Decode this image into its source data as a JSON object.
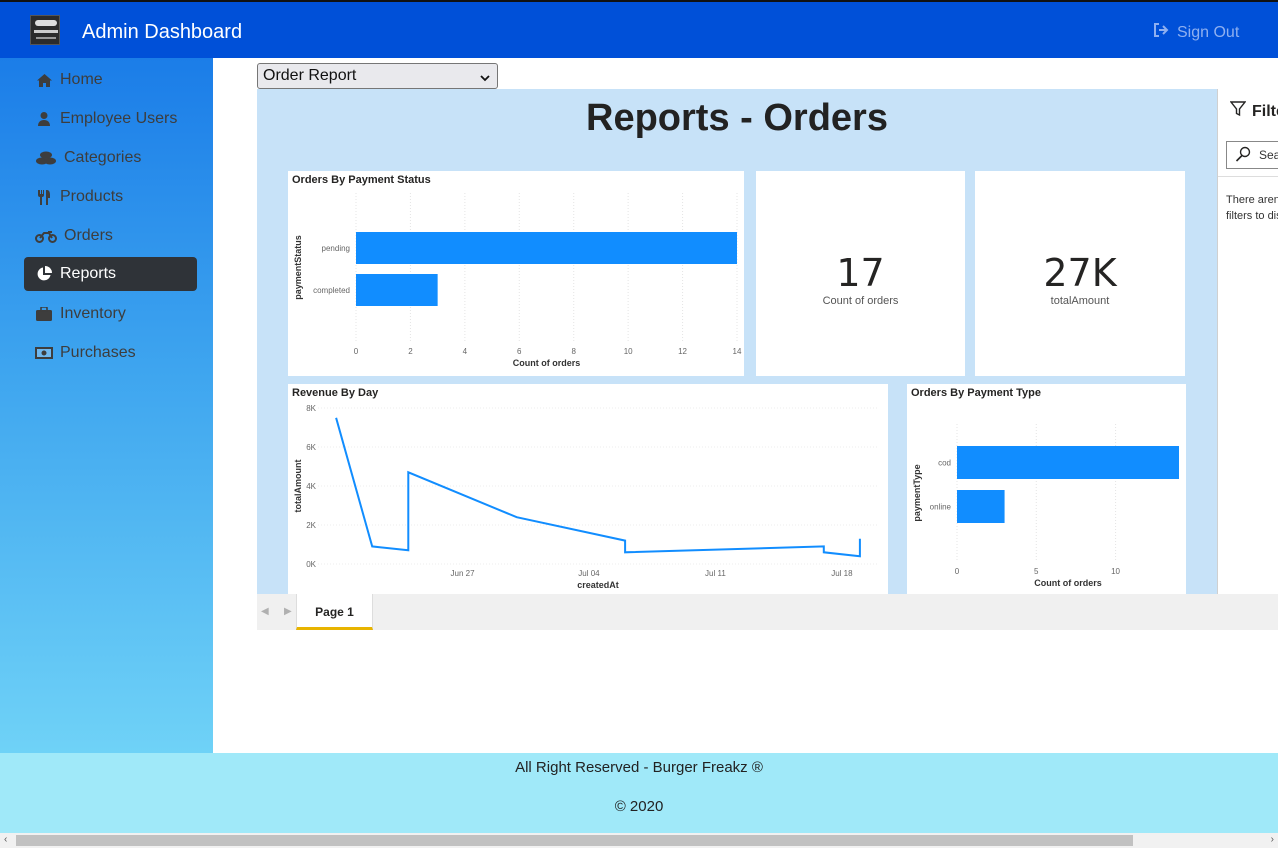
{
  "header": {
    "title": "Admin Dashboard",
    "sign_out_label": "Sign Out",
    "bg_color": "#0050d8"
  },
  "sidebar": {
    "items": [
      {
        "label": "Home",
        "icon": "home-icon",
        "active": false
      },
      {
        "label": "Employee Users",
        "icon": "user-icon",
        "active": false
      },
      {
        "label": "Categories",
        "icon": "coins-icon",
        "active": false
      },
      {
        "label": "Products",
        "icon": "utensils-icon",
        "active": false
      },
      {
        "label": "Orders",
        "icon": "motorcycle-icon",
        "active": false
      },
      {
        "label": "Reports",
        "icon": "pie-chart-icon",
        "active": true
      },
      {
        "label": "Inventory",
        "icon": "briefcase-icon",
        "active": false
      },
      {
        "label": "Purchases",
        "icon": "money-bill-icon",
        "active": false
      }
    ]
  },
  "report_selector": {
    "selected": "Order Report"
  },
  "report": {
    "title": "Reports - Orders",
    "cards": [
      {
        "value": "17",
        "label": "Count of orders"
      },
      {
        "value": "27K",
        "label": "totalAmount"
      }
    ],
    "charts": {
      "payment_status": {
        "title": "Orders By Payment Status"
      },
      "revenue_by_day": {
        "title": "Revenue By Day"
      },
      "payment_type": {
        "title": "Orders By Payment Type"
      }
    }
  },
  "filters": {
    "title": "Filters",
    "search_placeholder": "Search",
    "empty_message": "There aren't any filters to display."
  },
  "pages": {
    "tabs": [
      "Page 1"
    ],
    "active_tab": "Page 1"
  },
  "footer": {
    "line1": "All Right Reserved - Burger Freakz ®",
    "line2": "© 2020"
  },
  "chart_data": [
    {
      "type": "bar",
      "orientation": "horizontal",
      "title": "Orders By Payment Status",
      "ylabel": "paymentStatus",
      "xlabel": "Count of orders",
      "categories": [
        "pending",
        "completed"
      ],
      "values": [
        14,
        3
      ],
      "xlim": [
        0,
        14
      ],
      "xticks": [
        "0",
        "2",
        "4",
        "6",
        "8",
        "10",
        "12",
        "14"
      ],
      "color": "#118dff"
    },
    {
      "type": "line",
      "title": "Revenue By Day",
      "xlabel": "createdAt",
      "ylabel": "totalAmount",
      "x": [
        "2020-06-20",
        "2020-06-22",
        "2020-06-24",
        "2020-06-24",
        "2020-06-30",
        "2020-07-06",
        "2020-07-06",
        "2020-07-17",
        "2020-07-17",
        "2020-07-19",
        "2020-07-19",
        "2020-07-19"
      ],
      "y": [
        7500,
        900,
        700,
        4700,
        2400,
        1200,
        600,
        900,
        600,
        400,
        1300,
        600
      ],
      "ylim": [
        0,
        8000
      ],
      "yticks": [
        "0K",
        "2K",
        "4K",
        "6K",
        "8K"
      ],
      "xticks": [
        "Jun 27",
        "Jul 04",
        "Jul 11",
        "Jul 18"
      ],
      "color": "#118dff"
    },
    {
      "type": "bar",
      "orientation": "horizontal",
      "title": "Orders By Payment Type",
      "ylabel": "paymentType",
      "xlabel": "Count of orders",
      "categories": [
        "cod",
        "online"
      ],
      "values": [
        14,
        3
      ],
      "xlim": [
        0,
        14
      ],
      "xticks": [
        "0",
        "5",
        "10"
      ],
      "color": "#118dff"
    }
  ]
}
